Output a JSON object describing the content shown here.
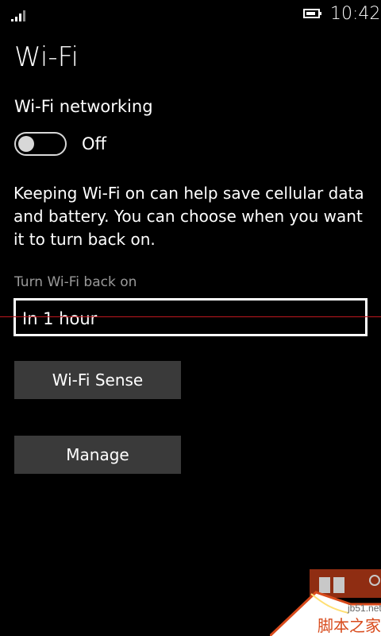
{
  "status_bar": {
    "time": "10:42",
    "signal_icon": "signal-strength-icon",
    "battery_icon": "battery-icon"
  },
  "page": {
    "title": "Wi-Fi"
  },
  "wifi_networking": {
    "label": "Wi-Fi networking",
    "state_text": "Off",
    "enabled": false
  },
  "description": "Keeping Wi-Fi on can help save cellular data and battery. You can choose when you want it to turn back on.",
  "turn_back_on": {
    "label": "Turn Wi-Fi back on",
    "selected_value": "In 1 hour"
  },
  "buttons": {
    "wifi_sense": "Wi-Fi Sense",
    "manage": "Manage"
  },
  "watermark": {
    "domain": "jb51.net",
    "chinese": "脚本之家"
  },
  "colors": {
    "background": "#000000",
    "text": "#ffffff",
    "muted_text": "#9a9a9a",
    "button": "#3a3a3a",
    "accent_line": "#c0171f",
    "watermark": "#d84a1b"
  }
}
